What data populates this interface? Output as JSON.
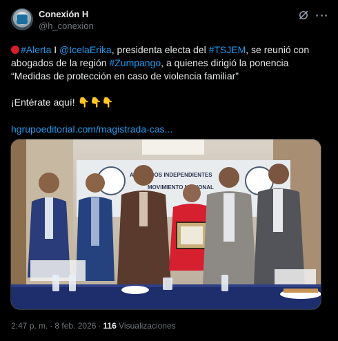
{
  "author": {
    "name": "Conexión H",
    "handle": "@h_conexion"
  },
  "post": {
    "line1": {
      "tag_alerta": "#Alerta",
      "sep1": " I ",
      "mention": "@IcelaErika",
      "text1": ", presidenta electa del ",
      "tag_tsjem": "#TSJEM",
      "text2": ", se reunió con"
    },
    "line2": {
      "text1": "abogados de la región ",
      "tag_zumpango": "#Zumpango",
      "text2": ", a quienes dirigió la ponencia"
    },
    "line3": "“Medidas de protección en caso de violencia familiar”",
    "cta": "¡Entérate aquí!",
    "cta_emoji": "👇👇👇",
    "url": "hgrupoeditorial.com/magistrada-cas..."
  },
  "photo": {
    "banner_left": "ABOGADOS INDEPENDIENTES",
    "banner_right": "MOVIMIENTO NACIONAL"
  },
  "meta": {
    "time": "2:47 p. m.",
    "dot": "·",
    "date": "8 feb. 2026",
    "dot2": "·",
    "views_count": "116",
    "views_label": "Visualizaciones"
  },
  "colors": {
    "background": "#000000",
    "text": "#e7e9ea",
    "secondary": "#71767b",
    "link": "#1d9bf0",
    "alert_red": "#d81d2a"
  },
  "icons": [
    "grok-icon",
    "more-icon"
  ]
}
